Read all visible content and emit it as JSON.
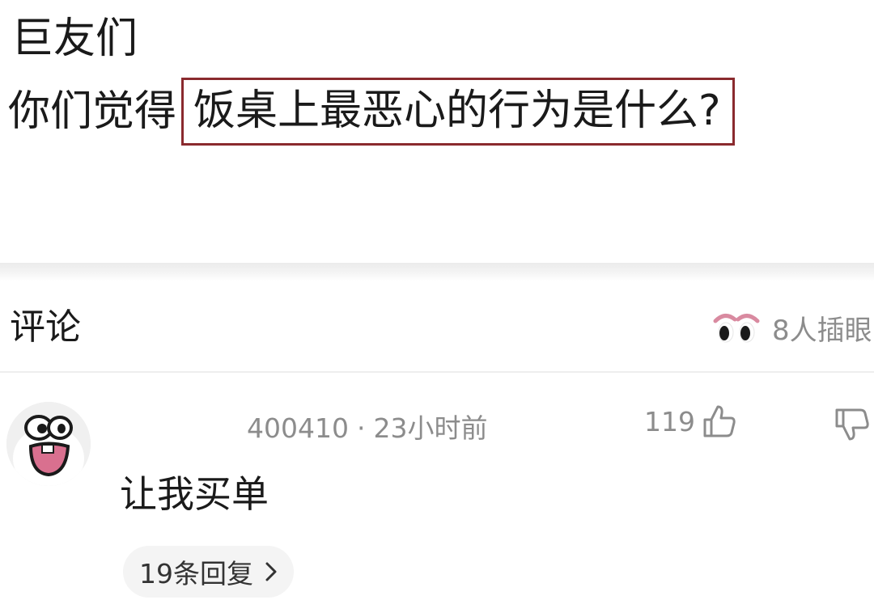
{
  "post": {
    "line1": "巨友们",
    "line2_prefix": "你们觉得",
    "line2_highlight": "饭桌上最恶心的行为是什么?"
  },
  "comments": {
    "title": "评论",
    "watching_label": "8人插眼"
  },
  "comment": {
    "username": "400410",
    "separator": "·",
    "time": "23小时前",
    "like_count": "119",
    "text": "让我买单",
    "replies_label": "19条回复"
  },
  "colors": {
    "highlight_border": "#8a2a2e",
    "meta_gray": "#8c8c8c",
    "eyes_pink": "#d98aa0"
  },
  "icons": [
    "eyes-icon",
    "thumb-up-icon",
    "thumb-down-icon",
    "chevron-right-icon",
    "avatar"
  ]
}
